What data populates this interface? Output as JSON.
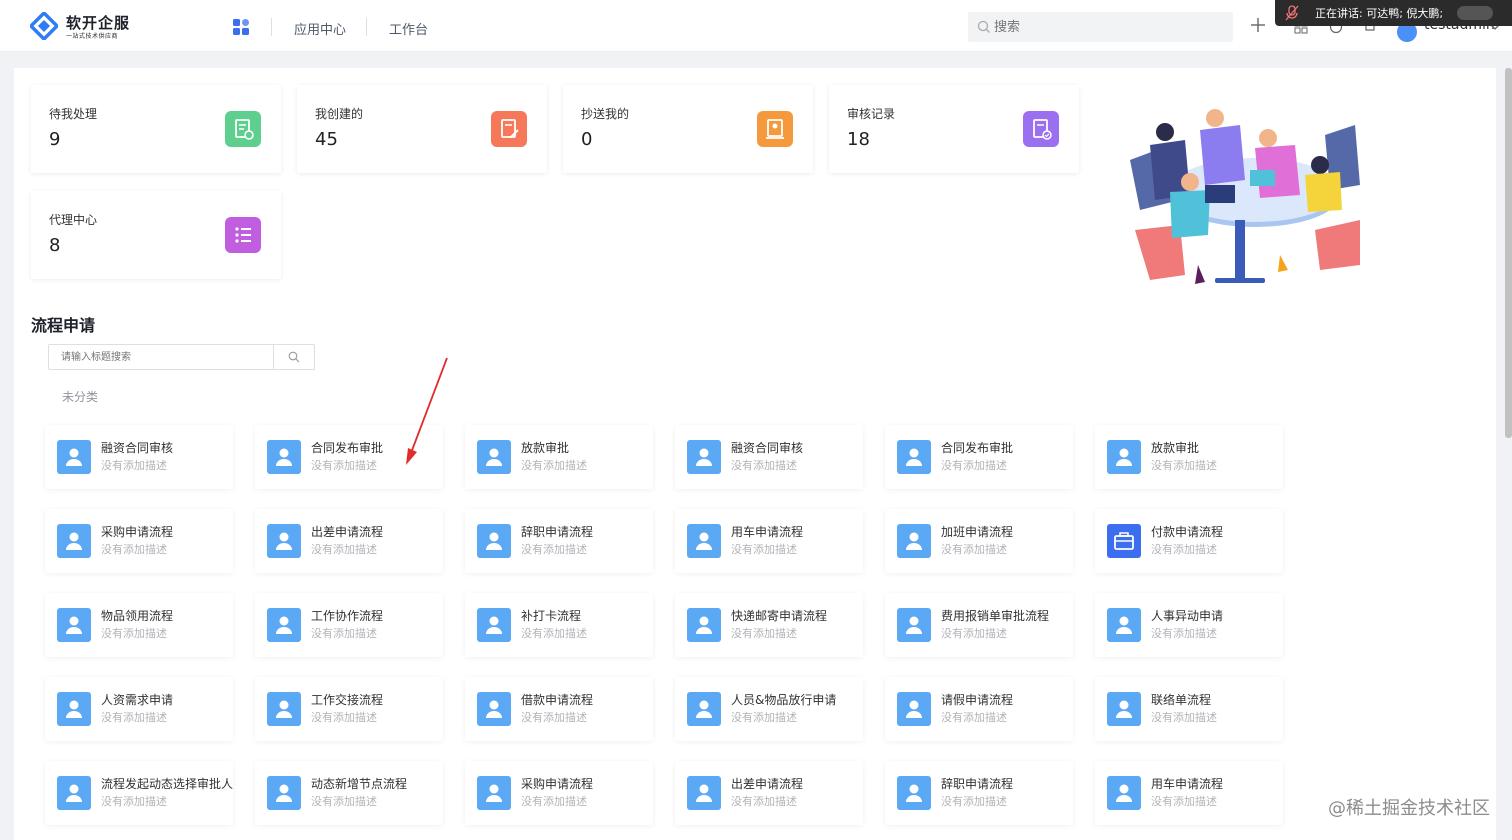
{
  "header": {
    "logo_title": "软开企服",
    "logo_subtitle": "一站式技术供应商",
    "nav": [
      "应用中心",
      "工作台"
    ],
    "search_placeholder": "搜索",
    "username": "testadmin",
    "speaking_text": "正在讲话: 可达鸭; 倪大鹏;"
  },
  "stats": [
    {
      "label": "待我处理",
      "value": "9",
      "color": "#5fcf8f",
      "icon": "document-clock-icon"
    },
    {
      "label": "我创建的",
      "value": "45",
      "color": "#f5785a",
      "icon": "document-edit-icon"
    },
    {
      "label": "抄送我的",
      "value": "0",
      "color": "#f59a3c",
      "icon": "document-user-icon"
    },
    {
      "label": "审核记录",
      "value": "18",
      "color": "#9a6ff0",
      "icon": "document-check-icon"
    },
    {
      "label": "代理中心",
      "value": "8",
      "color": "#c15ee0",
      "icon": "list-icon"
    }
  ],
  "flow": {
    "title": "流程申请",
    "search_placeholder": "请输入标题搜索",
    "category": "未分类",
    "items": [
      {
        "name": "融资合同审核",
        "desc": "没有添加描述"
      },
      {
        "name": "合同发布审批",
        "desc": "没有添加描述"
      },
      {
        "name": "放款审批",
        "desc": "没有添加描述"
      },
      {
        "name": "融资合同审核",
        "desc": "没有添加描述"
      },
      {
        "name": "合同发布审批",
        "desc": "没有添加描述"
      },
      {
        "name": "放款审批",
        "desc": "没有添加描述"
      },
      {
        "name": "采购申请流程",
        "desc": "没有添加描述"
      },
      {
        "name": "出差申请流程",
        "desc": "没有添加描述"
      },
      {
        "name": "辞职申请流程",
        "desc": "没有添加描述"
      },
      {
        "name": "用车申请流程",
        "desc": "没有添加描述"
      },
      {
        "name": "加班申请流程",
        "desc": "没有添加描述"
      },
      {
        "name": "付款申请流程",
        "desc": "没有添加描述"
      },
      {
        "name": "物品领用流程",
        "desc": "没有添加描述"
      },
      {
        "name": "工作协作流程",
        "desc": "没有添加描述"
      },
      {
        "name": "补打卡流程",
        "desc": "没有添加描述"
      },
      {
        "name": "快递邮寄申请流程",
        "desc": "没有添加描述"
      },
      {
        "name": "费用报销单审批流程",
        "desc": "没有添加描述"
      },
      {
        "name": "人事异动申请",
        "desc": "没有添加描述"
      },
      {
        "name": "人资需求申请",
        "desc": "没有添加描述"
      },
      {
        "name": "工作交接流程",
        "desc": "没有添加描述"
      },
      {
        "name": "借款申请流程",
        "desc": "没有添加描述"
      },
      {
        "name": "人员&物品放行申请",
        "desc": "没有添加描述"
      },
      {
        "name": "请假申请流程",
        "desc": "没有添加描述"
      },
      {
        "name": "联络单流程",
        "desc": "没有添加描述"
      },
      {
        "name": "流程发起动态选择审批人",
        "desc": "没有添加描述"
      },
      {
        "name": "动态新增节点流程",
        "desc": "没有添加描述"
      },
      {
        "name": "采购申请流程",
        "desc": "没有添加描述"
      },
      {
        "name": "出差申请流程",
        "desc": "没有添加描述"
      },
      {
        "name": "辞职申请流程",
        "desc": "没有添加描述"
      },
      {
        "name": "用车申请流程",
        "desc": "没有添加描述"
      }
    ]
  },
  "watermark": "@稀土掘金技术社区"
}
